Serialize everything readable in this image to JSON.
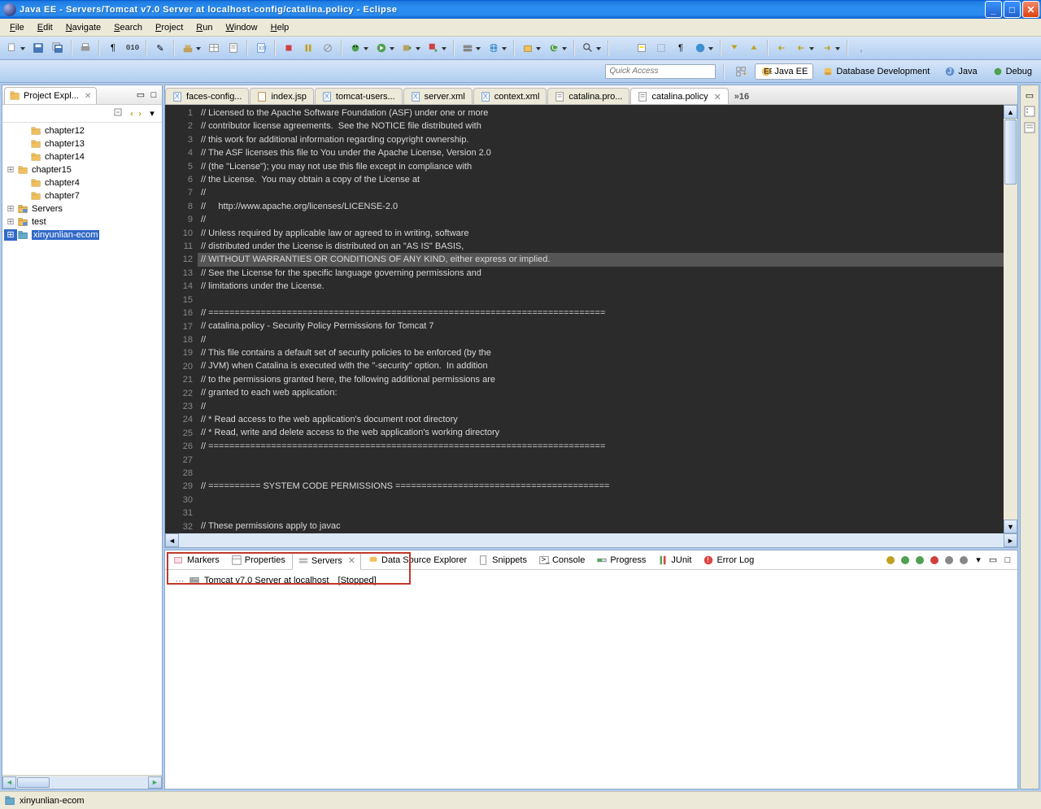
{
  "window": {
    "title": "Java EE - Servers/Tomcat v7.0 Server at localhost-config/catalina.policy - Eclipse"
  },
  "menu": [
    "File",
    "Edit",
    "Navigate",
    "Search",
    "Project",
    "Run",
    "Window",
    "Help"
  ],
  "quick_access_placeholder": "Quick Access",
  "perspectives": [
    {
      "label": "Java EE",
      "active": true
    },
    {
      "label": "Database Development",
      "active": false
    },
    {
      "label": "Java",
      "active": false
    },
    {
      "label": "Debug",
      "active": false
    }
  ],
  "project_explorer": {
    "title": "Project Expl...",
    "items": [
      {
        "indent": 1,
        "exp": "",
        "icon": "folder",
        "label": "chapter12"
      },
      {
        "indent": 1,
        "exp": "",
        "icon": "folder",
        "label": "chapter13"
      },
      {
        "indent": 1,
        "exp": "",
        "icon": "folder",
        "label": "chapter14"
      },
      {
        "indent": 0,
        "exp": "+",
        "icon": "folder",
        "label": "chapter15"
      },
      {
        "indent": 1,
        "exp": "",
        "icon": "folder",
        "label": "chapter4"
      },
      {
        "indent": 1,
        "exp": "",
        "icon": "folder",
        "label": "chapter7"
      },
      {
        "indent": 0,
        "exp": "+",
        "icon": "folder-blue",
        "label": "Servers"
      },
      {
        "indent": 0,
        "exp": "+",
        "icon": "folder-blue",
        "label": "test"
      },
      {
        "indent": 0,
        "exp": "+",
        "icon": "project",
        "label": "xinyunlian-ecom",
        "selected": true
      }
    ]
  },
  "editor_tabs": [
    {
      "label": "faces-config...",
      "icon": "xml"
    },
    {
      "label": "index.jsp",
      "icon": "jsp"
    },
    {
      "label": "tomcat-users...",
      "icon": "xml"
    },
    {
      "label": "server.xml",
      "icon": "xml"
    },
    {
      "label": "context.xml",
      "icon": "xml"
    },
    {
      "label": "catalina.pro...",
      "icon": "file"
    },
    {
      "label": "catalina.policy",
      "icon": "file",
      "active": true,
      "close": true
    }
  ],
  "editor_overflow": "»16",
  "code_lines": [
    "// Licensed to the Apache Software Foundation (ASF) under one or more",
    "// contributor license agreements.  See the NOTICE file distributed with",
    "// this work for additional information regarding copyright ownership.",
    "// The ASF licenses this file to You under the Apache License, Version 2.0",
    "// (the \"License\"); you may not use this file except in compliance with",
    "// the License.  You may obtain a copy of the License at",
    "//",
    "//     http://www.apache.org/licenses/LICENSE-2.0",
    "//",
    "// Unless required by applicable law or agreed to in writing, software",
    "// distributed under the License is distributed on an \"AS IS\" BASIS,",
    "// WITHOUT WARRANTIES OR CONDITIONS OF ANY KIND, either express or implied.",
    "// See the License for the specific language governing permissions and",
    "// limitations under the License.",
    "",
    "// ============================================================================",
    "// catalina.policy - Security Policy Permissions for Tomcat 7",
    "//",
    "// This file contains a default set of security policies to be enforced (by the",
    "// JVM) when Catalina is executed with the \"-security\" option.  In addition",
    "// to the permissions granted here, the following additional permissions are",
    "// granted to each web application:",
    "//",
    "// * Read access to the web application's document root directory",
    "// * Read, write and delete access to the web application's working directory",
    "// ============================================================================",
    "",
    "",
    "// ========== SYSTEM CODE PERMISSIONS =========================================",
    "",
    "",
    "// These permissions apply to javac"
  ],
  "highlighted_line_index": 11,
  "bottom_tabs": [
    {
      "label": "Markers"
    },
    {
      "label": "Properties"
    },
    {
      "label": "Servers",
      "active": true
    },
    {
      "label": "Data Source Explorer"
    },
    {
      "label": "Snippets"
    },
    {
      "label": "Console"
    },
    {
      "label": "Progress"
    },
    {
      "label": "JUnit"
    },
    {
      "label": "Error Log"
    }
  ],
  "server_entry": {
    "name": "Tomcat v7.0 Server at localhost",
    "state": "[Stopped]"
  },
  "statusbar_project": "xinyunlian-ecom"
}
